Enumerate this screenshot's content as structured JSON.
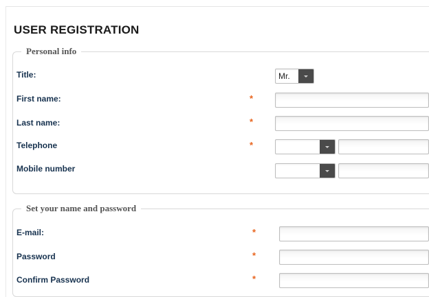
{
  "page": {
    "title": "USER REGISTRATION"
  },
  "personal_info": {
    "legend": "Personal info",
    "required_mark": "*",
    "title_label": "Title:",
    "title_value": "Mr.",
    "first_name_label": "First name:",
    "first_name_value": "",
    "last_name_label": "Last name:",
    "last_name_value": "",
    "telephone_label": "Telephone",
    "telephone_prefix": "",
    "telephone_value": "",
    "mobile_label": "Mobile number",
    "mobile_prefix": "",
    "mobile_value": ""
  },
  "credentials": {
    "legend": "Set your name and password",
    "required_mark": "*",
    "email_label": "E-mail:",
    "email_value": "",
    "password_label": "Password",
    "password_value": "",
    "confirm_password_label": "Confirm Password",
    "confirm_password_value": ""
  },
  "colors": {
    "label": "#17324f",
    "required": "#e8651f",
    "select_arrow": "#4a4a4a",
    "legend": "#555555"
  },
  "icons": {
    "dropdown": "chevron-down-icon"
  }
}
